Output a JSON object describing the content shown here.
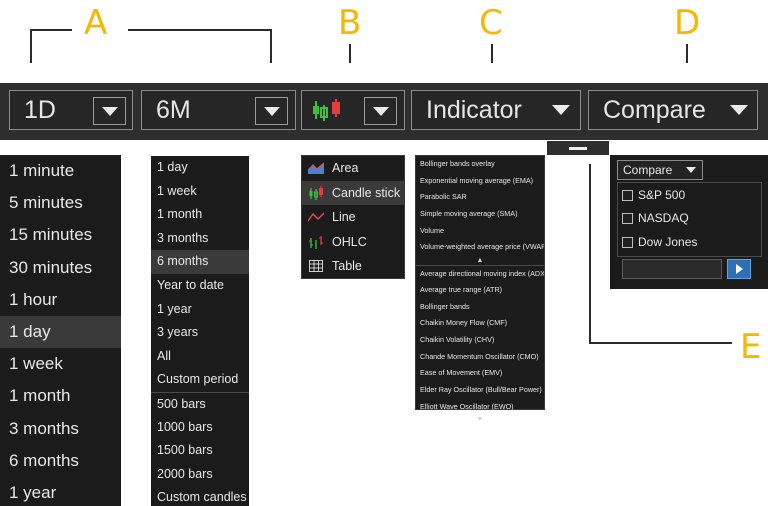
{
  "callouts": {
    "a": "A",
    "b": "B",
    "c": "C",
    "d": "D",
    "e": "E"
  },
  "toolbar": {
    "interval_value": "1D",
    "range_value": "6M",
    "indicator_label": "Indicator",
    "compare_label": "Compare"
  },
  "intervals": [
    "1 minute",
    "5 minutes",
    "15 minutes",
    "30 minutes",
    "1 hour",
    "1 day",
    "1 week",
    "1 month",
    "3 months",
    "6 months",
    "1 year"
  ],
  "intervals_selected": "1 day",
  "ranges": [
    "1 day",
    "1 week",
    "1 month",
    "3 months",
    "6 months",
    "Year to date",
    "1 year",
    "3 years",
    "All",
    "Custom period",
    "500 bars",
    "1000 bars",
    "1500 bars",
    "2000 bars",
    "Custom candles"
  ],
  "ranges_selected": "6 months",
  "chart_types": [
    {
      "label": "Area",
      "icon": "area-chart-icon"
    },
    {
      "label": "Candle stick",
      "icon": "candlestick-icon"
    },
    {
      "label": "Line",
      "icon": "line-chart-icon"
    },
    {
      "label": "OHLC",
      "icon": "ohlc-icon"
    },
    {
      "label": "Table",
      "icon": "table-icon"
    }
  ],
  "chart_types_selected": "Candle stick",
  "indicators_overlay": [
    "Bollinger bands overlay",
    "Exponential moving average (EMA)",
    "Parabolic SAR",
    "Simple moving average (SMA)",
    "Volume",
    "Volume-weighted average price (VWAP)"
  ],
  "indicators_study": [
    "Average directional moving index (ADX)",
    "Average true range (ATR)",
    "Bollinger bands",
    "Chaikin Money Flow (CMF)",
    "Chaikin Volatility (CHV)",
    "Chande Momentum Oscillator (CMO)",
    "Ease of Movement (EMV)",
    "Elder Ray Oscillator (Bull/Bear Power)",
    "Elliott Wave Oscillator (EWO)"
  ],
  "compare_panel": {
    "dropdown_label": "Compare",
    "options": [
      "S&P 500",
      "NASDAQ",
      "Dow Jones"
    ],
    "input_value": ""
  },
  "colors": {
    "callout": "#f5b800",
    "panel_bg": "#1b1b1b",
    "toolbar_bg": "#2e2e2e",
    "go_button": "#2d6fb5"
  }
}
